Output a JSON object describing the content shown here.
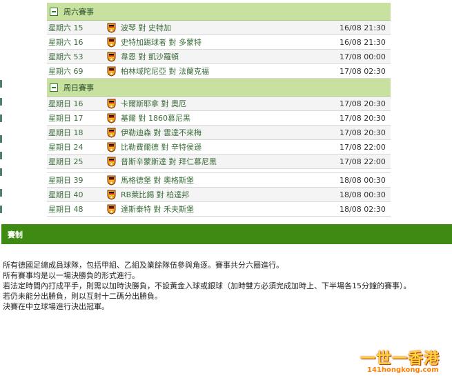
{
  "schedule": {
    "saturday": {
      "title": "周六賽事",
      "matches": [
        {
          "day": "星期六 15",
          "teams": "波琴 對 史特加",
          "time": "16/08 21:30"
        },
        {
          "day": "星期六 16",
          "teams": "史特加踢球者 對 多蒙特",
          "time": "16/08 21:30"
        },
        {
          "day": "星期六 53",
          "teams": "韋恩 對 凱沙羅頓",
          "time": "17/08 00:00"
        },
        {
          "day": "星期六 69",
          "teams": "柏林域陀尼亞 對 法蘭克福",
          "time": "17/08 02:30"
        }
      ]
    },
    "sunday": {
      "title": "周日賽事",
      "matches": [
        {
          "day": "星期日 16",
          "teams": "卡爾斯耶拿 對 奧厄",
          "time": "17/08 20:30"
        },
        {
          "day": "星期日 17",
          "teams": "基爾 對 1860慕尼黑",
          "time": "17/08 20:30"
        },
        {
          "day": "星期日 18",
          "teams": "伊勒迪森 對 雲達不來梅",
          "time": "17/08 20:30"
        },
        {
          "day": "星期日 24",
          "teams": "比勒費爾德 對 辛特侯遜",
          "time": "17/08 22:00"
        },
        {
          "day": "星期日 25",
          "teams": "普斯辛蒙斯達 對 拜仁慕尼黑",
          "time": "17/08 22:00"
        },
        {
          "day": "星期日 39",
          "teams": "馬格德堡 對 奧格斯堡",
          "time": "18/08 00:30"
        },
        {
          "day": "星期日 40",
          "teams": "RB萊比錫 對 柏達邦",
          "time": "18/08 00:30"
        },
        {
          "day": "星期日 48",
          "teams": "達斯泰特 對 禾夫斯堡",
          "time": "18/08 02:30"
        }
      ]
    }
  },
  "rules": {
    "title": "賽制",
    "lines": [
      "所有德國足總成員球隊，包括甲組、乙組及業餘隊伍參與角逐。賽事共分六圈進行。",
      "所有賽事均是以一場決勝負的形式進行。",
      "若法定時間內打成平手，則需以加時決勝負，不設黃金入球或銀球（加時雙方必須完成加時上、下半場各15分鐘的賽事）。",
      "若仍未能分出勝負，則以互射十二碼分出勝負。",
      "決賽在中立球場進行決出冠軍。"
    ]
  },
  "watermark": {
    "main": "一世一香港",
    "sub": "141hongkong.com"
  },
  "icons": {
    "section_toggle": "collapse-icon",
    "match_crest": "dfb-pokal-crest-icon"
  },
  "colors": {
    "section_header": "#c8e0a0",
    "rules_bar": "#3f8a12",
    "link_green": "#3b6c3b"
  }
}
